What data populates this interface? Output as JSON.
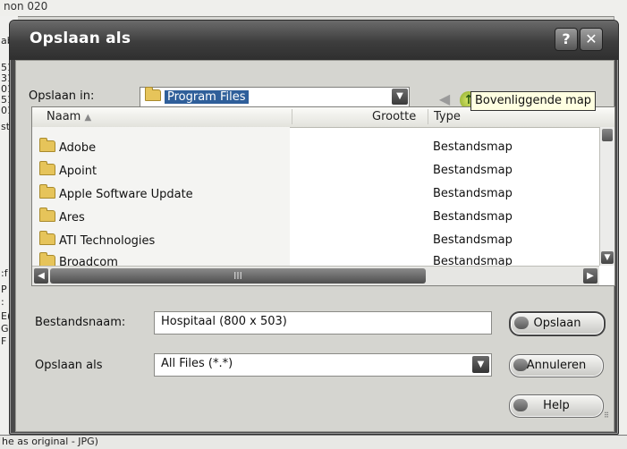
{
  "background": {
    "top_fragment": "non 020",
    "left_fragments": [
      "ab",
      "51",
      "31",
      "01",
      "51",
      "01",
      "st",
      ":f",
      "P",
      ":",
      "E(",
      "G",
      "F"
    ],
    "bottom_text": "he as original - JPG)"
  },
  "dialog": {
    "title": "Opslaan als",
    "help_button": "?",
    "close_button": "✕",
    "save_in_label": "Opslaan in:",
    "save_in_value": "Program Files",
    "tooltip": "Bovenliggende map",
    "columns": {
      "name": "Naam",
      "size": "Grootte",
      "type": "Type"
    },
    "rows": [
      {
        "name": "Adobe",
        "type": "Bestandsmap"
      },
      {
        "name": "Apoint",
        "type": "Bestandsmap"
      },
      {
        "name": "Apple Software Update",
        "type": "Bestandsmap"
      },
      {
        "name": "Ares",
        "type": "Bestandsmap"
      },
      {
        "name": "ATI Technologies",
        "type": "Bestandsmap"
      },
      {
        "name": "Broadcom",
        "type": "Bestandsmap"
      }
    ],
    "filename_label": "Bestandsnaam:",
    "filename_value": "Hospitaal (800 x 503)",
    "filetype_label": "Opslaan als",
    "filetype_value": "All Files (*.*)",
    "buttons": {
      "save": "Opslaan",
      "cancel": "Annuleren",
      "help": "Help"
    },
    "hscroll_label": "III",
    "icons": [
      "back-arrow-icon",
      "up-folder-icon",
      "new-folder-icon",
      "view-menu-icon",
      "folder-icon"
    ]
  }
}
